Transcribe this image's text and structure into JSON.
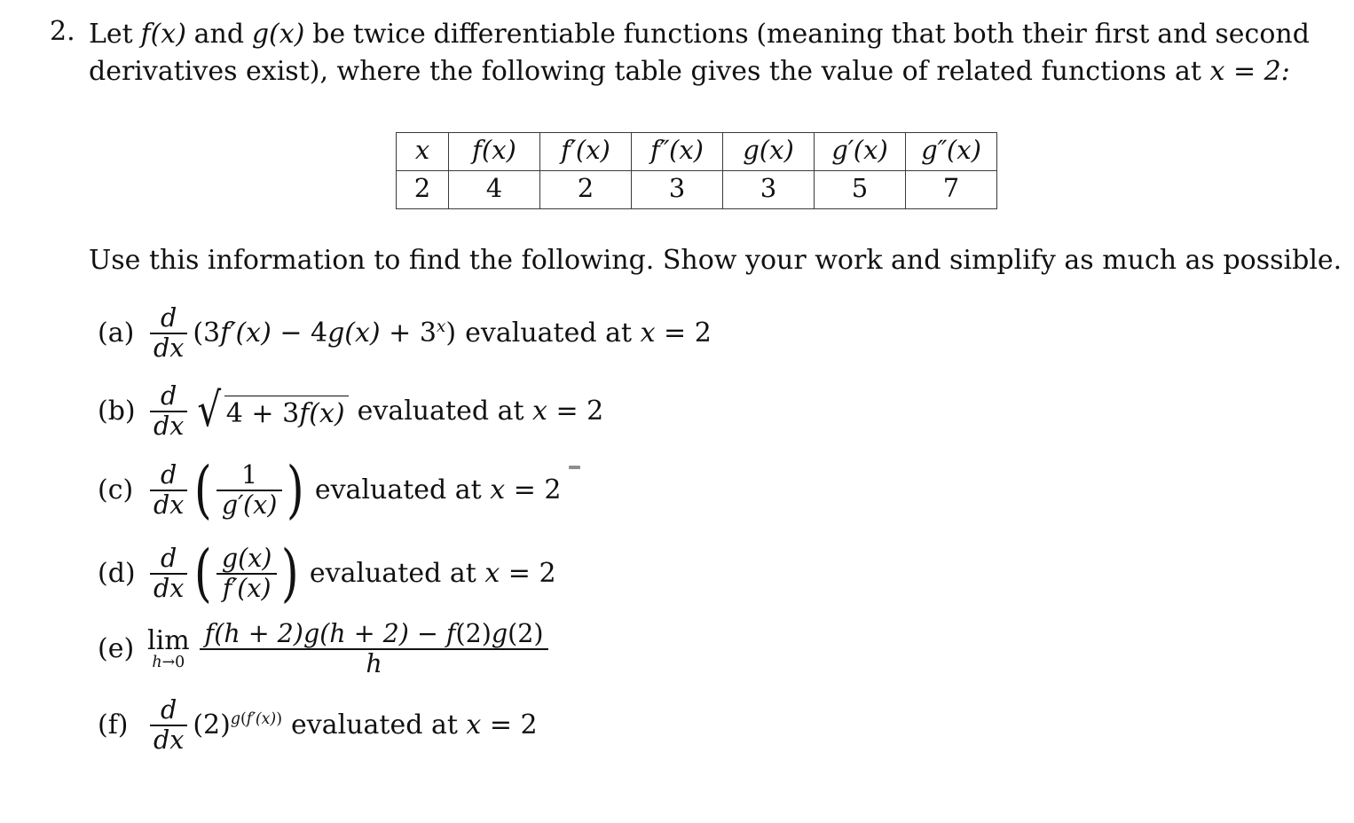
{
  "document": {
    "type": "calculus-worksheet-problem",
    "background_color": "#ffffff",
    "text_color": "#111111"
  },
  "problem": {
    "number": "2.",
    "statement_line_1_segments": [
      "Let ",
      "f(x)",
      " and ",
      "g(x)",
      " be twice differentiable functions (meaning that both their first and second"
    ],
    "statement_line_1_words": [
      "Let",
      "f(x)",
      "and",
      "g(x)",
      "be",
      "twice",
      "differentiable",
      "functions",
      "(meaning",
      "that",
      "both",
      "their",
      "first",
      "and",
      "second"
    ],
    "statement_line_2_words": [
      "derivatives",
      "exist),",
      "where",
      "the",
      "following",
      "table",
      "gives",
      "the",
      "value",
      "of",
      "related",
      "functions",
      "at",
      "x = 2:"
    ],
    "instruction": "Use this information to find the following.  Show your work and simplify as much as possible."
  },
  "table": {
    "headers": [
      "x",
      "f(x)",
      "f''(x)",
      "f\"(x)",
      "g(x)",
      "g'(x)",
      "g\"(x)"
    ],
    "header_cells": [
      {
        "base": "x",
        "primes": "",
        "arg": ""
      },
      {
        "base": "f",
        "primes": "",
        "arg": "(x)"
      },
      {
        "base": "f",
        "primes": "′",
        "arg": "(x)"
      },
      {
        "base": "f",
        "primes": "″",
        "arg": "(x)"
      },
      {
        "base": "g",
        "primes": "",
        "arg": "(x)"
      },
      {
        "base": "g",
        "primes": "′",
        "arg": "(x)"
      },
      {
        "base": "g",
        "primes": "″",
        "arg": "(x)"
      }
    ],
    "values": [
      "2",
      "4",
      "2",
      "3",
      "3",
      "5",
      "7"
    ]
  },
  "parts": {
    "a": {
      "label": "(a)",
      "frac_num": "d",
      "frac_den": "dx",
      "expr_open": "(3",
      "expr_f": "f",
      "expr_f_prime": "′",
      "expr_f_arg": "(x)",
      "expr_minus": " − 4",
      "expr_g": "g",
      "expr_g_arg": "(x)",
      "expr_plus": " + 3",
      "expr_exp": "x",
      "expr_close": ")",
      "tail": "evaluated at ",
      "tail_var": "x",
      "tail_eq": " = 2"
    },
    "b": {
      "label": "(b)",
      "frac_num": "d",
      "frac_den": "dx",
      "radical_sign": "√",
      "radicand_pre": "4 + 3",
      "radicand_f": "f",
      "radicand_arg": "(x)",
      "tail": "evaluated at ",
      "tail_var": "x",
      "tail_eq": " = 2"
    },
    "c": {
      "label": "(c)",
      "frac_num": "d",
      "frac_den": "dx",
      "paren_open": "(",
      "inner_num": "1",
      "inner_den_base": "g",
      "inner_den_prime": "′",
      "inner_den_arg": "(x)",
      "paren_close": ")",
      "tail": "evaluated at ",
      "tail_var": "x",
      "tail_eq": " = 2",
      "stray_mark": true
    },
    "d": {
      "label": "(d)",
      "frac_num": "d",
      "frac_den": "dx",
      "paren_open": "(",
      "inner_num_base": "g",
      "inner_num_arg": "(x)",
      "inner_den_base": "f",
      "inner_den_prime": "′",
      "inner_den_arg": "(x)",
      "paren_close": ")",
      "tail": "evaluated at ",
      "tail_var": "x",
      "tail_eq": " = 2"
    },
    "e": {
      "label": "(e)",
      "lim_op": "lim",
      "lim_sub_var": "h",
      "lim_sub_arrow": "→0",
      "num_f1": "f",
      "num_f1_arg": "(h + 2)",
      "num_g1": "g",
      "num_g1_arg": "(h + 2)",
      "num_minus": " − ",
      "num_f2": "f",
      "num_f2_arg": "(2)",
      "num_g2": "g",
      "num_g2_arg": "(2)",
      "den": "h"
    },
    "f": {
      "label": "(f)",
      "frac_num": "d",
      "frac_den": "dx",
      "base": "(2)",
      "exp_g": "g",
      "exp_open": "(",
      "exp_f": "f",
      "exp_f_prime": "′",
      "exp_f_arg": "(x)",
      "exp_close": ")",
      "tail": "evaluated at ",
      "tail_var": "x",
      "tail_eq": " = 2"
    }
  }
}
